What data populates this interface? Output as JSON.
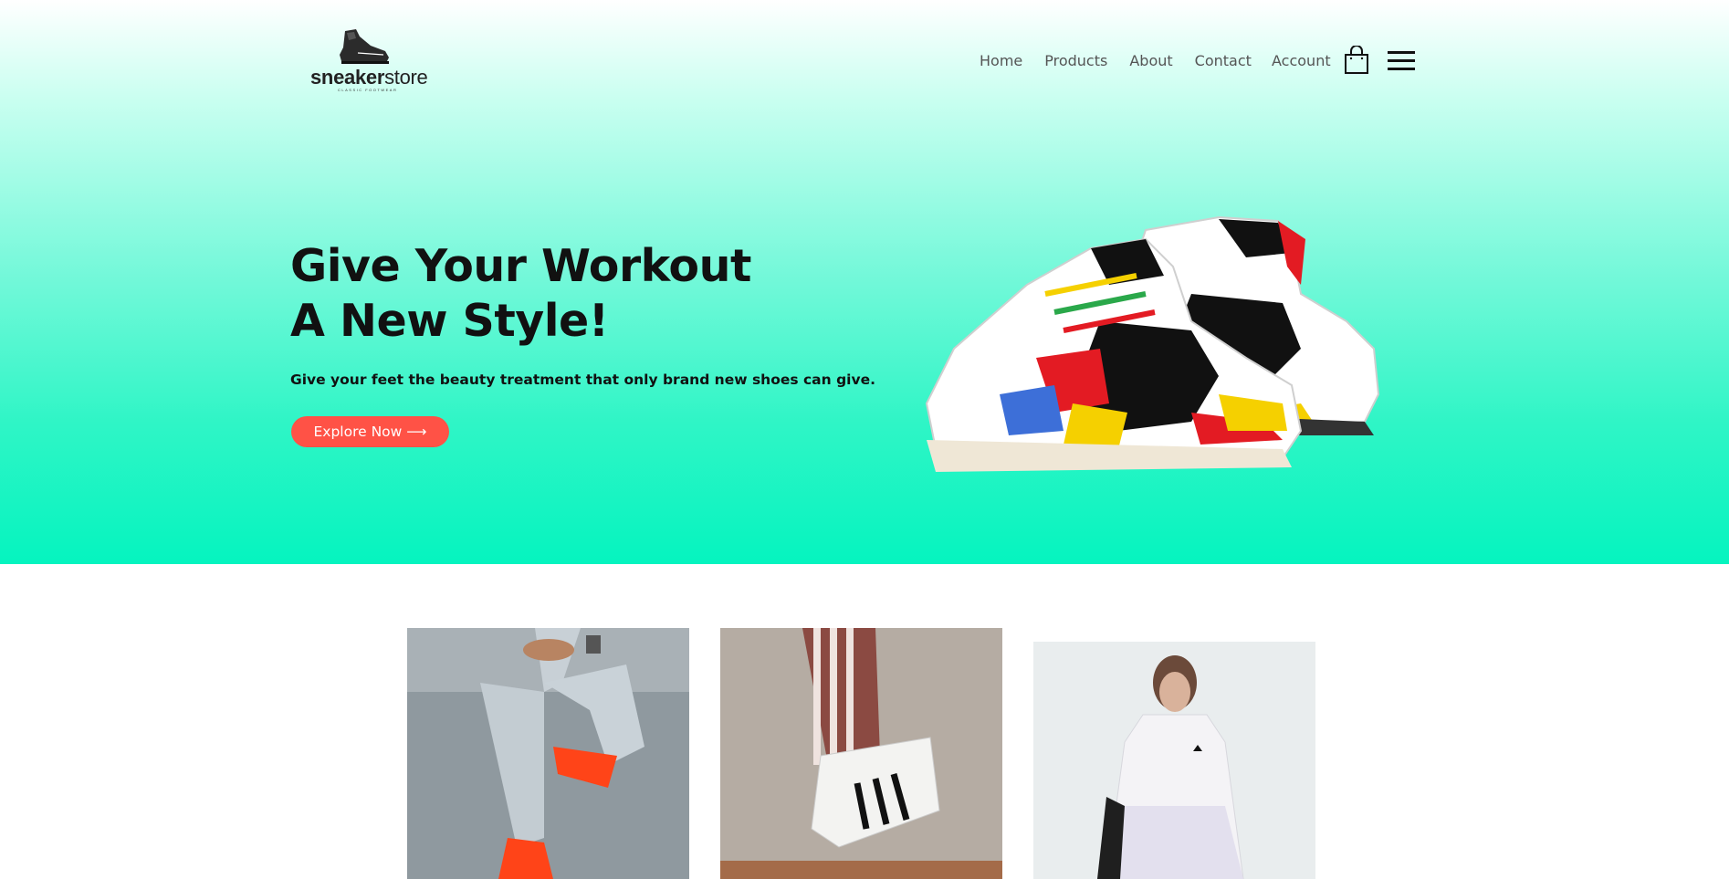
{
  "brand": {
    "name_bold": "sneaker",
    "name_light": "store",
    "tagline": "CLASSIC FOOTWEAR"
  },
  "nav": {
    "items": [
      {
        "label": "Home"
      },
      {
        "label": "Products"
      },
      {
        "label": "About"
      },
      {
        "label": "Contact"
      }
    ],
    "account_label": "Account",
    "icons": [
      "shopping-bag-icon",
      "hamburger-menu-icon"
    ]
  },
  "hero": {
    "title_line1": "Give Your Workout",
    "title_line2": "A New Style!",
    "subtitle": "Give your feet the beauty treatment that only brand new shoes can give.",
    "cta_label": "Explore Now ⟶"
  },
  "colors": {
    "hero_gradient_top": "#ffffff",
    "hero_gradient_bottom": "#05f4bf",
    "cta_background": "#ff5246",
    "nav_text": "#555555"
  },
  "product_images": [
    {
      "subject": "person in ripped jeans with orange sneakers"
    },
    {
      "subject": "leg in striped track pants with white striped sneaker"
    },
    {
      "subject": "woman in white hooded jacket"
    }
  ]
}
